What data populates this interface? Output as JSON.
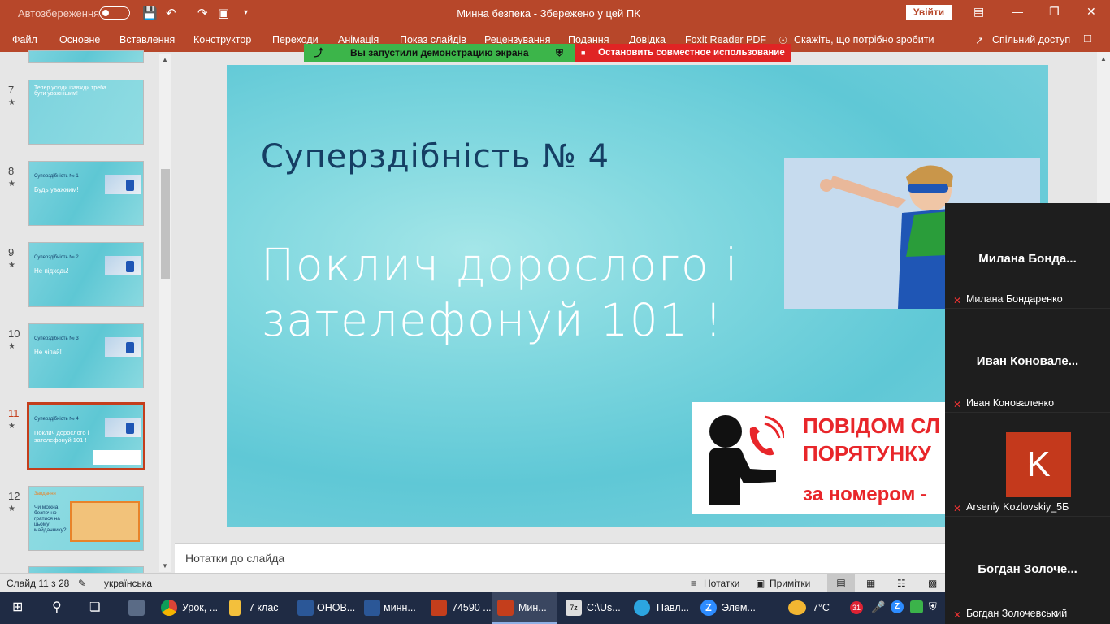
{
  "titlebar": {
    "autosave_label": "Автозбереження",
    "document_title": "Минна безпека  -  Збережено у цей ПК",
    "signin_label": "Увійти"
  },
  "ribbon": {
    "tabs": [
      "Файл",
      "Основне",
      "Вставлення",
      "Конструктор",
      "Переходи",
      "Анімація",
      "Показ слайдів",
      "Рецензування",
      "Подання",
      "Довідка",
      "Foxit Reader PDF"
    ],
    "tell_me": "Скажіть, що потрібно зробити",
    "share": "Спільний доступ"
  },
  "sharing": {
    "sharing_text": "Вы запустили демонстрацию экрана",
    "stop_text": "Остановить совместное использование",
    "accent_green": "#3cb54a",
    "accent_red": "#e02424"
  },
  "thumbnails": [
    {
      "num": "7",
      "line1": "Тепер усюди ізавжди треба бути уважнішим!",
      "line2": ""
    },
    {
      "num": "8",
      "line1": "Суперздібність № 1",
      "line2": "Будь уважним!"
    },
    {
      "num": "9",
      "line1": "Суперздібність № 2",
      "line2": "Не підходь!"
    },
    {
      "num": "10",
      "line1": "Суперздібність № 3",
      "line2": "Не чіпай!"
    },
    {
      "num": "11",
      "line1": "Суперздібність № 4",
      "line2": "Поклич дорослого і зателефонуй 101 !"
    },
    {
      "num": "12",
      "line1": "Завдання",
      "line2": "Чи можна безпечно гратися на цьому майданчику?"
    },
    {
      "num": "13",
      "line1": "",
      "line2": ""
    }
  ],
  "slide": {
    "heading": "Суперздібність № 4",
    "body": "Поклич дорослого і зателефонуй 101 !",
    "banner_line1": "ПОВІДОМ СЛ",
    "banner_line2": "ПОРЯТУНКУ",
    "banner_line3": "за номером -"
  },
  "notes_placeholder": "Нотатки до слайда",
  "status": {
    "slide_counter": "Слайд 11 з 28",
    "language": "українська",
    "notes_btn": "Нотатки",
    "comments_btn": "Примітки"
  },
  "participants": [
    {
      "display": "Милана  Бонда...",
      "label": "Милана Бондаренко",
      "avatar": ""
    },
    {
      "display": "Иван  Коновале...",
      "label": "Иван Коноваленко",
      "avatar": ""
    },
    {
      "display": "",
      "label": "Arseniy Kozlovskiy_5Б",
      "avatar": "K"
    },
    {
      "display": "Богдан  Золоче...",
      "label": "Богдан Золочевський",
      "avatar": ""
    }
  ],
  "taskbar": {
    "items": [
      "Урок, ...",
      "7 клас",
      "ОНОВ...",
      "минн...",
      "74590 ...",
      "Мин...",
      "C:\\Us...",
      "Павл...",
      "Элем..."
    ],
    "weather": "7°C"
  }
}
